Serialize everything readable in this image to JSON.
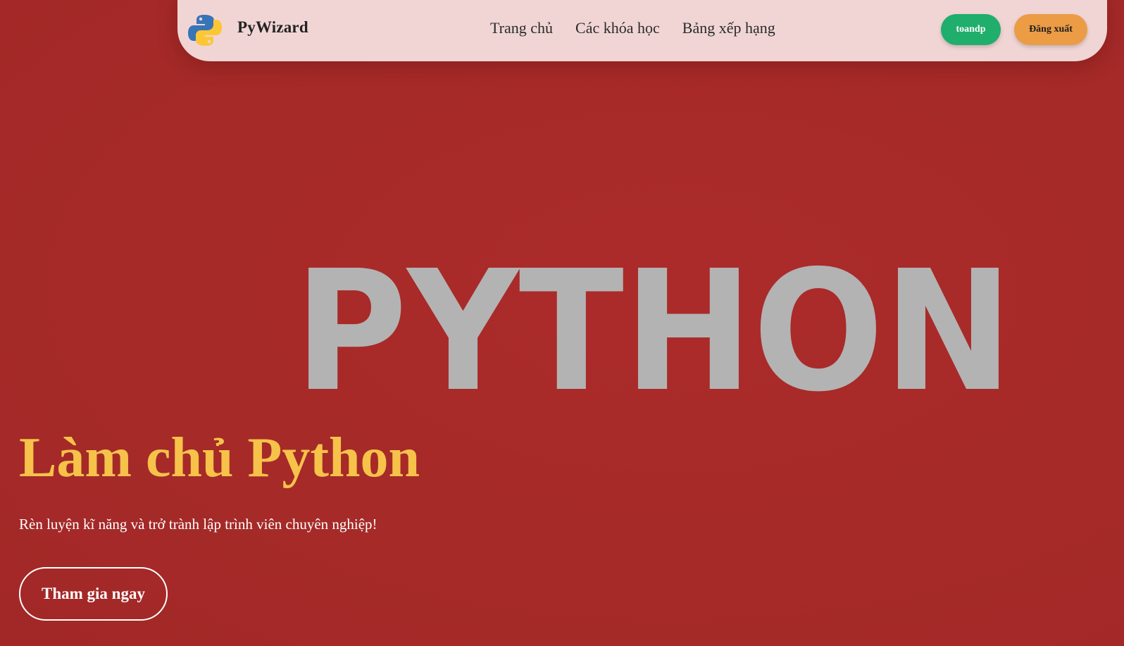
{
  "nav": {
    "brand": "PyWizard",
    "logo_icon": "python-logo-icon",
    "links": [
      "Trang chủ",
      "Các khóa học",
      "Bảng xếp hạng"
    ],
    "user_label": "toandp",
    "logout_label": "Đăng xuất"
  },
  "hero": {
    "wordmark": "PYTHON",
    "title": "Làm chủ Python",
    "subtitle": "Rèn luyện kĩ năng và trở trành lập trình viên chuyên nghiệp!",
    "cta_label": "Tham gia ngay"
  },
  "colors": {
    "background": "#a72a2a",
    "navbar": "#f1d5d5",
    "title": "#f6c24a",
    "user_button": "#1fae6b",
    "logout_button": "#ec9c45",
    "wordmark": "#b3b3b3"
  }
}
